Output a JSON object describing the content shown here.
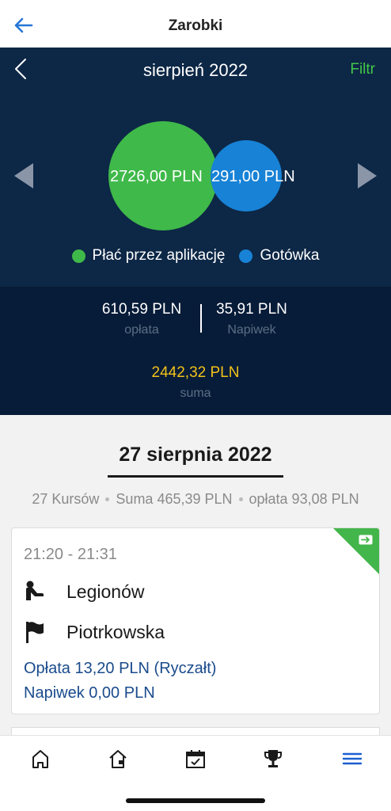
{
  "header": {
    "title": "Zarobki"
  },
  "summary": {
    "month": "sierpień 2022",
    "filter_label": "Filtr",
    "app_amount": "2726,00 PLN",
    "cash_amount": "291,00 PLN",
    "legend": {
      "app": "Płać przez aplikację",
      "cash": "Gotówka"
    }
  },
  "totals": {
    "fee_value": "610,59 PLN",
    "fee_label": "opłata",
    "tip_value": "35,91 PLN",
    "tip_label": "Napiwek",
    "sum_value": "2442,32 PLN",
    "sum_label": "suma"
  },
  "day": {
    "title": "27 sierpnia 2022",
    "rides": "27 Kursów",
    "total": "Suma 465,39 PLN",
    "fee": "opłata 93,08 PLN"
  },
  "ride": {
    "time": "21:20 - 21:31",
    "pickup": "Legionów",
    "dropoff": "Piotrkowska",
    "fee": "Opłata 13,20 PLN (Ryczałt)",
    "tip": "Napiwek 0,00 PLN"
  },
  "colors": {
    "app_green": "#3fb94a",
    "cash_blue": "#1782d6",
    "header_navy": "#0d2746",
    "filter_green": "#42c648",
    "sum_yellow": "#f2c21a",
    "nav_accent": "#1a5fd0"
  },
  "icons": {
    "back": "arrow-left-icon",
    "prev_month": "chevron-left-icon",
    "pickup": "passenger-icon",
    "dropoff": "flag-icon",
    "card_corner": "exit-icon",
    "nav": [
      "home-icon",
      "house-badge-icon",
      "calendar-check-icon",
      "trophy-icon",
      "menu-icon"
    ]
  }
}
